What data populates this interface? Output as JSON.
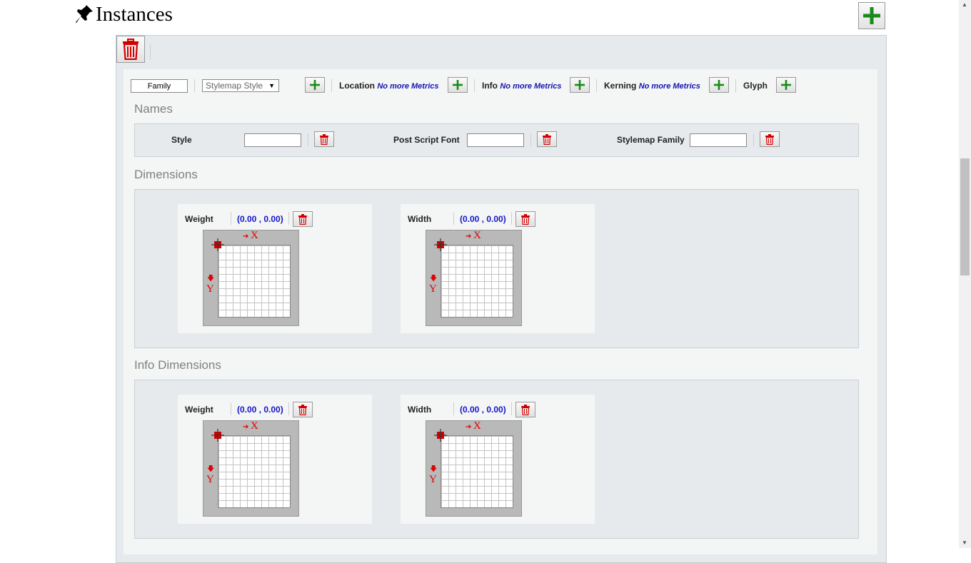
{
  "header": {
    "title": "Instances",
    "pin_icon": "pin-icon",
    "add_icon": "plus-icon"
  },
  "toolbar": {
    "family_value": "Family",
    "stylemap_style_value": "Stylemap Style",
    "stylemap_arrow": "▼",
    "location_label": "Location",
    "location_note": "No more Metrics",
    "info_label": "Info",
    "info_note": "No more Metrics",
    "kerning_label": "Kerning",
    "kerning_note": "No more Metrics",
    "glyph_label": "Glyph"
  },
  "names": {
    "title": "Names",
    "fields": [
      {
        "label": "Style",
        "value": ""
      },
      {
        "label": "Post Script Font",
        "value": ""
      },
      {
        "label": "Stylemap Family",
        "value": ""
      }
    ]
  },
  "dimensions": {
    "title": "Dimensions",
    "cards": [
      {
        "label": "Weight",
        "value": "(0.00 , 0.00)"
      },
      {
        "label": "Width",
        "value": "(0.00 , 0.00)"
      }
    ]
  },
  "info_dimensions": {
    "title": "Info Dimensions",
    "cards": [
      {
        "label": "Weight",
        "value": "(0.00 , 0.00)"
      },
      {
        "label": "Width",
        "value": "(0.00 , 0.00)"
      }
    ]
  },
  "axis": {
    "x": "X",
    "y": "Y",
    "x_arrow": "➔",
    "y_arrow": "🡇"
  },
  "colors": {
    "accent_green": "#1a8a1a",
    "delete_red": "#d40000",
    "value_blue": "#1515c8",
    "note_blue": "#1515b0"
  }
}
